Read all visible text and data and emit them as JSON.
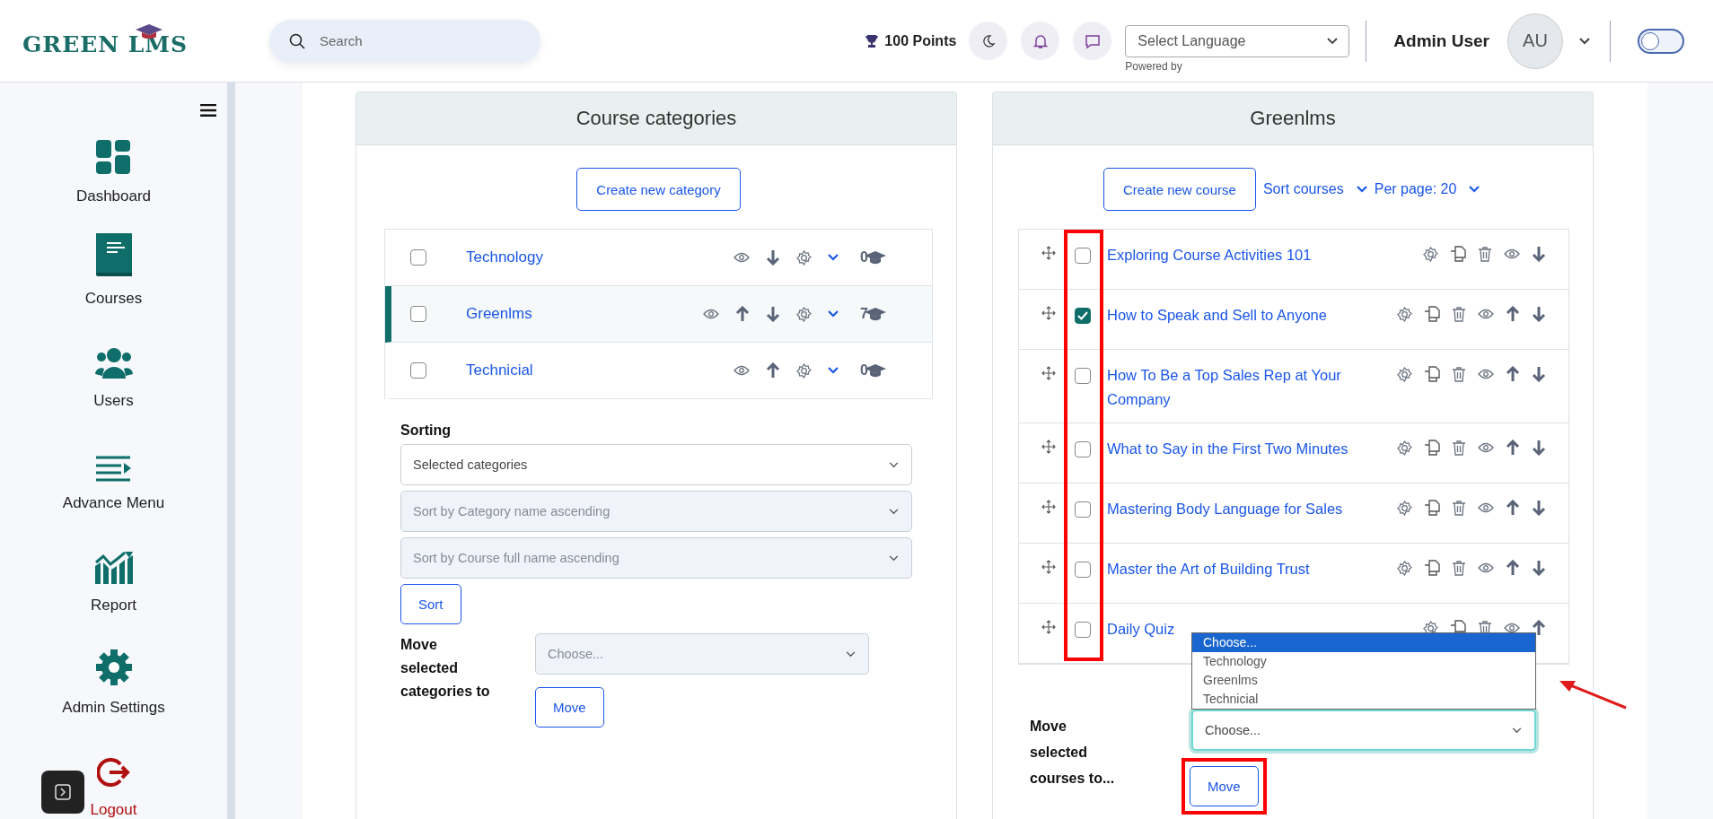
{
  "header": {
    "logo": "GREEN LMS",
    "search": {
      "placeholder": "Search"
    },
    "points": "100 Points",
    "language": {
      "value": "Select Language",
      "note": "Powered by"
    },
    "user": {
      "name": "Admin User",
      "initials": "AU"
    },
    "toggle": {
      "on": false
    }
  },
  "sidebar": {
    "items": [
      {
        "label": "Dashboard",
        "kind": "nav"
      },
      {
        "label": "Courses",
        "kind": "nav"
      },
      {
        "label": "Users",
        "kind": "nav"
      },
      {
        "label": "Advance Menu",
        "kind": "nav"
      },
      {
        "label": "Report",
        "kind": "nav"
      },
      {
        "label": "Admin Settings",
        "kind": "nav"
      },
      {
        "label": "Logout",
        "kind": "logout"
      }
    ]
  },
  "categories_panel": {
    "title": "Course categories",
    "create_button": "Create new category",
    "rows": [
      {
        "name": "Technology",
        "checked": false,
        "current": false,
        "up": false,
        "down": true,
        "count": "0"
      },
      {
        "name": "Greenlms",
        "checked": false,
        "current": true,
        "up": true,
        "down": true,
        "count": "7"
      },
      {
        "name": "Technicial",
        "checked": false,
        "current": false,
        "up": true,
        "down": false,
        "count": "0"
      }
    ],
    "sorting": {
      "label": "Sorting",
      "selects": [
        {
          "value": "Selected categories",
          "disabled": false
        },
        {
          "value": "Sort by Category name ascending",
          "disabled": true
        },
        {
          "value": "Sort by Course full name ascending",
          "disabled": true
        }
      ],
      "button": "Sort"
    },
    "move": {
      "label": "Move selected categories to",
      "select": {
        "value": "Choose...",
        "disabled": true
      },
      "button": "Move"
    }
  },
  "courses_panel": {
    "title": "Greenlms",
    "create_button": "Create new course",
    "sort_link": "Sort courses",
    "per_page": "Per page: 20",
    "rows": [
      {
        "title": "Exploring Course Activities 101",
        "checked": false,
        "up": false,
        "down": true
      },
      {
        "title": "How to Speak and Sell to Anyone",
        "checked": true,
        "up": true,
        "down": true
      },
      {
        "title": "How To Be a Top Sales Rep at Your Company",
        "checked": false,
        "up": true,
        "down": true
      },
      {
        "title": "What to Say in the First Two Minutes",
        "checked": false,
        "up": true,
        "down": true
      },
      {
        "title": "Mastering Body Language for Sales",
        "checked": false,
        "up": true,
        "down": true
      },
      {
        "title": "Master the Art of Building Trust",
        "checked": false,
        "up": true,
        "down": true
      },
      {
        "title": "Daily Quiz",
        "checked": false,
        "up": true,
        "down": false
      }
    ],
    "move": {
      "label": "Move selected courses to...",
      "select": {
        "value": "Choose...",
        "expanded": true,
        "options": [
          {
            "label": "Choose...",
            "selected": true
          },
          {
            "label": "Technology",
            "selected": false
          },
          {
            "label": "Greenlms",
            "selected": false
          },
          {
            "label": "Technicial",
            "selected": false
          }
        ]
      },
      "button": "Move"
    }
  }
}
